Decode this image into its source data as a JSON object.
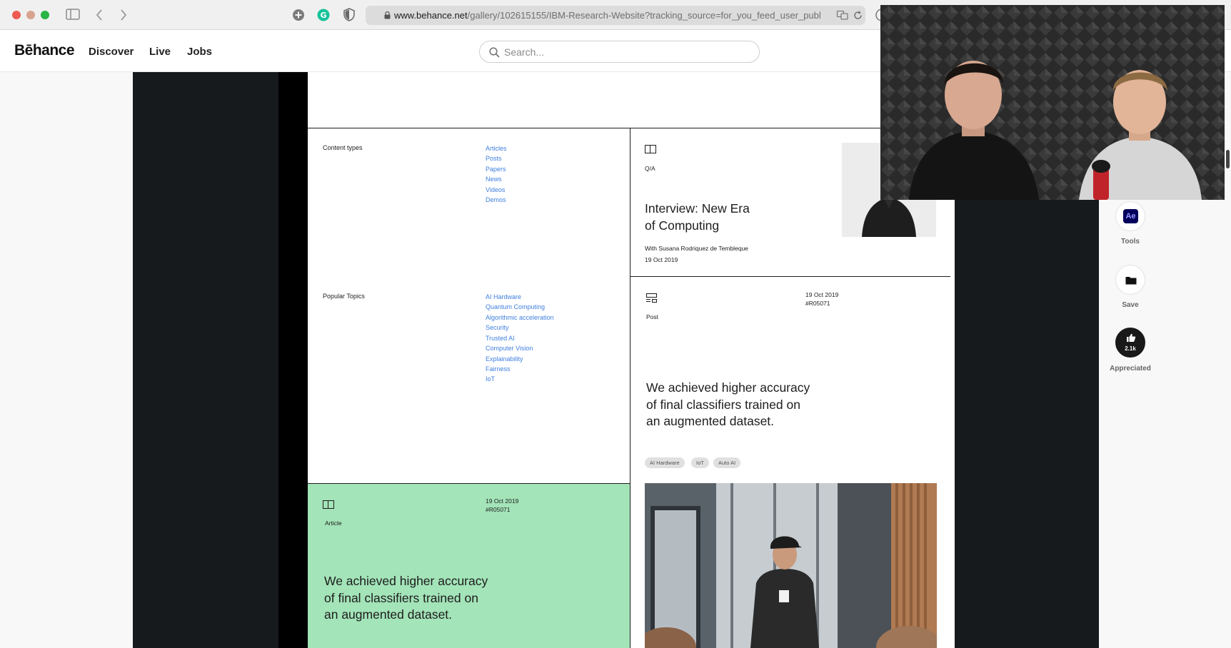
{
  "browser": {
    "url_host": "www.behance.net",
    "url_path": "/gallery/102615155/IBM-Research-Website?tracking_source=for_you_feed_user_publ"
  },
  "site": {
    "logo": "Bēhance",
    "nav": [
      "Discover",
      "Live",
      "Jobs"
    ],
    "search_placeholder": "Search..."
  },
  "project": {
    "content_types": {
      "heading": "Content types",
      "links": [
        "Articles",
        "Posts",
        "Papers",
        "News",
        "Videos",
        "Demos"
      ]
    },
    "popular_topics": {
      "heading": "Popular Topics",
      "links": [
        "AI Hardware",
        "Quantum Computing",
        "Algorithmic acceleration",
        "Security",
        "Trusted AI",
        "Computer Vision",
        "Explainability",
        "Fairness",
        "IoT"
      ]
    },
    "qa_card": {
      "type": "Q/A",
      "title_line1": "Interview: New Era",
      "title_line2": "of Computing",
      "byline": "With Susana Rodriquez de Tembleque",
      "date": "19 Oct 2019"
    },
    "post_card": {
      "date": "19 Oct 2019",
      "ref": "#R05071",
      "type": "Post",
      "headline_line1": "We achieved higher accuracy",
      "headline_line2": "of final classifiers trained on",
      "headline_line3": "an augmented dataset.",
      "tags": [
        "AI Hardware",
        "IoT",
        "Auto AI"
      ]
    },
    "article_card": {
      "date": "19 Oct 2019",
      "ref": "#R05071",
      "type": "Article",
      "headline_line1": "We achieved higher accuracy",
      "headline_line2": "of final classifiers trained on",
      "headline_line3": "an augmented dataset.",
      "bg_color": "#a3e4b8"
    }
  },
  "rail": {
    "tool_badge": "Ae",
    "tools_label": "Tools",
    "save_label": "Save",
    "appreciate_count": "2.1k",
    "appreciated_label": "Appreciated"
  },
  "colors": {
    "link": "#3f7fe0",
    "dark_panel": "#171a1d",
    "ae_badge": "#00005b"
  }
}
